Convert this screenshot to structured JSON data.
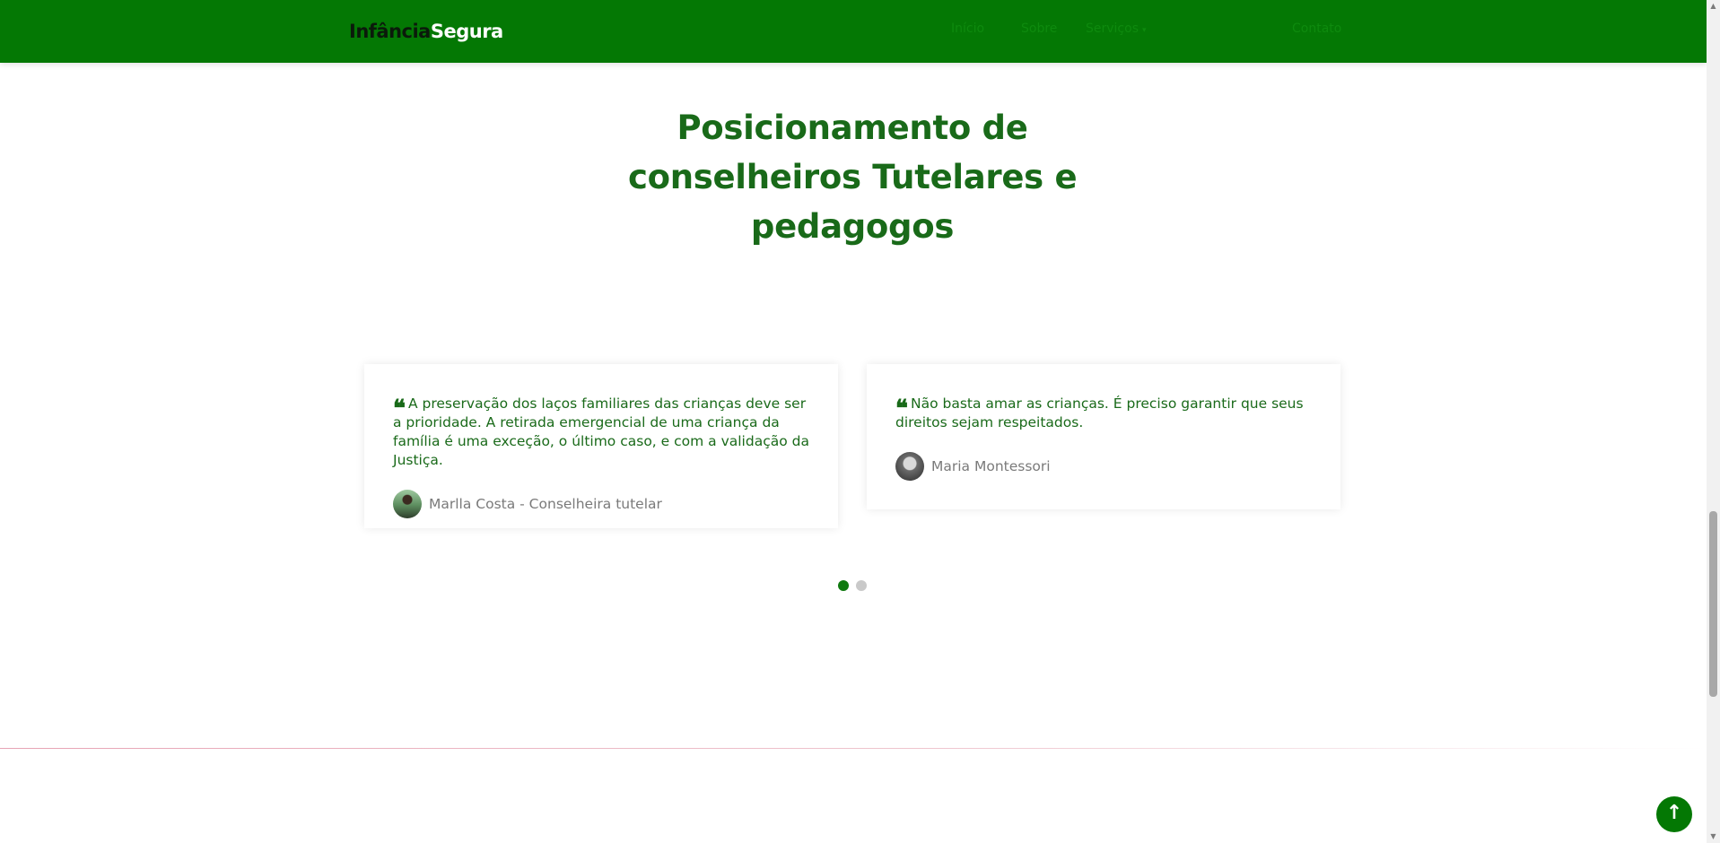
{
  "navbar": {
    "logo_part1": "Infância",
    "logo_part2": "Segura",
    "links": [
      "Início",
      "Sobre",
      "Serviços",
      "Contato"
    ],
    "dropdown_caret": "▾"
  },
  "section": {
    "title_lines": [
      "Posicionamento de",
      "conselheiros Tutelares e",
      "pedagogos"
    ]
  },
  "testimonials": [
    {
      "quote_mark": "❝",
      "quote": "A preservação dos laços familiares das crianças deve ser a prioridade. A retirada emergencial de uma criança da família é uma exceção, o último caso, e com a validação da Justiça.",
      "author": "Marlla Costa - Conselheira tutelar"
    },
    {
      "quote_mark": "❝",
      "quote": "Não basta amar as crianças. É preciso garantir que seus direitos sejam respeitados.",
      "author": "Maria Montessori"
    }
  ],
  "carousel": {
    "pages": 2,
    "active_index": 0
  },
  "back_to_top": {
    "icon": "arrow-up-icon",
    "glyph": "↑"
  },
  "scrollbar": {
    "up_glyph": "▲",
    "down_glyph": "▼"
  },
  "colors": {
    "brand_green": "#047804",
    "title_green": "#196a19",
    "quote_green": "#1a6a1a",
    "author_gray": "#7a7a7a"
  }
}
